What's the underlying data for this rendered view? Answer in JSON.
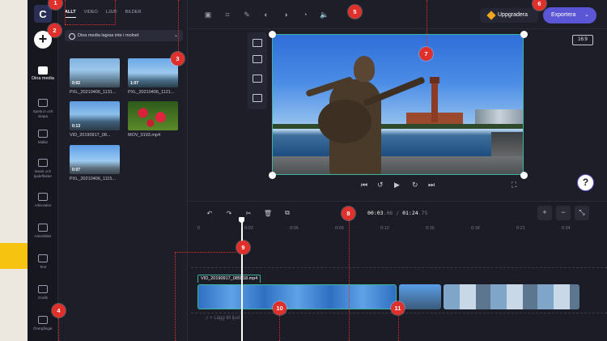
{
  "app": {
    "name": "Clipchamp"
  },
  "media_panel": {
    "tabs": [
      "ALLT",
      "VIDEO",
      "LJUD",
      "BILDER"
    ],
    "cloud_notice": "Dina media lagras inte i molnet",
    "items": [
      {
        "name": "PXL_20210406_1131...",
        "duration": "0:02",
        "thumb": "sign"
      },
      {
        "name": "PXL_20210406_1121...",
        "duration": "1:07",
        "thumb": "tower"
      },
      {
        "name": "VID_20190917_08...",
        "duration": "0:13",
        "thumb": "statue"
      },
      {
        "name": "MOV_0193.mp4",
        "duration": "",
        "thumb": "flower"
      },
      {
        "name": "PXL_20210406_1115...",
        "duration": "0:07",
        "thumb": "statue2"
      }
    ]
  },
  "rail": {
    "items": [
      {
        "label": "Dina media",
        "icon": "folder-icon"
      },
      {
        "label": "Spela in och skapa",
        "icon": "record-icon"
      },
      {
        "label": "Mallar",
        "icon": "templates-icon"
      },
      {
        "label": "Musik och ljudeffekter",
        "icon": "music-icon"
      },
      {
        "label": "Arkivvideo",
        "icon": "stock-video-icon"
      },
      {
        "label": "Arkivbilder",
        "icon": "stock-image-icon"
      },
      {
        "label": "Text",
        "icon": "text-icon"
      },
      {
        "label": "Grafik",
        "icon": "graphics-icon"
      },
      {
        "label": "Övergångar",
        "icon": "transitions-icon"
      }
    ]
  },
  "header": {
    "upgrade_label": "Uppgradera",
    "export_label": "Exportera"
  },
  "preview": {
    "aspect_ratio": "16:9"
  },
  "timeline": {
    "current_time": "00:03",
    "current_frac": ".06",
    "total_time": "01:24",
    "total_frac": ".75",
    "separator": "/",
    "ticks": [
      "0",
      "0:03",
      "0:06",
      "0:09",
      "0:12",
      "0:15",
      "0:18",
      "0:21",
      "0:24"
    ],
    "clip_label": "VID_20190917_085518.mp4",
    "audio_placeholder": "+ Lägg till ljud"
  },
  "callouts": [
    "1",
    "2",
    "3",
    "4",
    "5",
    "6",
    "7",
    "8",
    "9",
    "10",
    "11"
  ]
}
